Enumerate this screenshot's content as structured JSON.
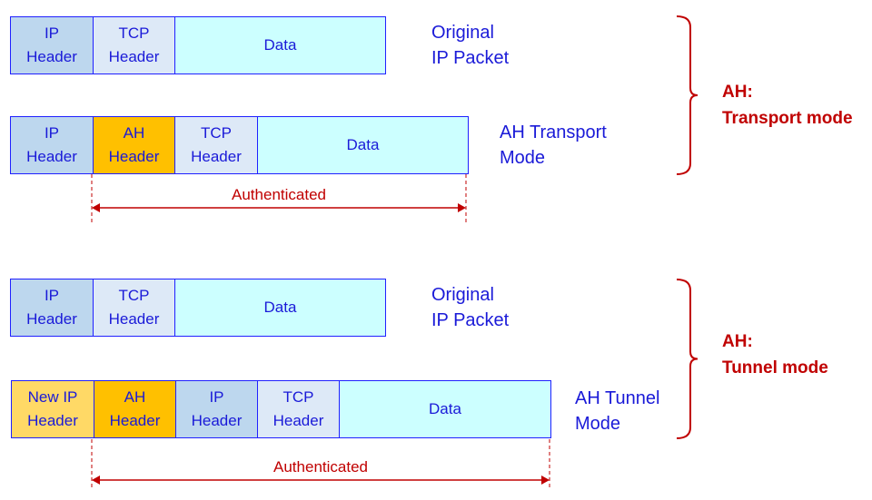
{
  "colors": {
    "ip_header": "#bdd7ee",
    "tcp_header": "#dde9f7",
    "data": "#ccffff",
    "ah_header": "#ffc000",
    "new_ip_header": "#ffd966",
    "text_blue": "#1a1ad8",
    "accent_red": "#c00000"
  },
  "groups": [
    {
      "mode_label": "AH:\nTransport mode",
      "packets": [
        {
          "caption": "Original\nIP Packet",
          "segments": [
            {
              "label": "IP\nHeader",
              "type": "ip_header"
            },
            {
              "label": "TCP\nHeader",
              "type": "tcp_header"
            },
            {
              "label": "Data",
              "type": "data"
            }
          ]
        },
        {
          "caption": "AH Transport\nMode",
          "segments": [
            {
              "label": "IP\nHeader",
              "type": "ip_header"
            },
            {
              "label": "AH\nHeader",
              "type": "ah_header"
            },
            {
              "label": "TCP\nHeader",
              "type": "tcp_header"
            },
            {
              "label": "Data",
              "type": "data"
            }
          ],
          "authenticated_label": "Authenticated"
        }
      ]
    },
    {
      "mode_label": "AH:\nTunnel mode",
      "packets": [
        {
          "caption": "Original\nIP Packet",
          "segments": [
            {
              "label": "IP\nHeader",
              "type": "ip_header"
            },
            {
              "label": "TCP\nHeader",
              "type": "tcp_header"
            },
            {
              "label": "Data",
              "type": "data"
            }
          ]
        },
        {
          "caption": "AH Tunnel\nMode",
          "segments": [
            {
              "label": "New IP\nHeader",
              "type": "new_ip_header"
            },
            {
              "label": "AH\nHeader",
              "type": "ah_header"
            },
            {
              "label": "IP\nHeader",
              "type": "ip_header"
            },
            {
              "label": "TCP\nHeader",
              "type": "tcp_header"
            },
            {
              "label": "Data",
              "type": "data"
            }
          ],
          "authenticated_label": "Authenticated"
        }
      ]
    }
  ]
}
